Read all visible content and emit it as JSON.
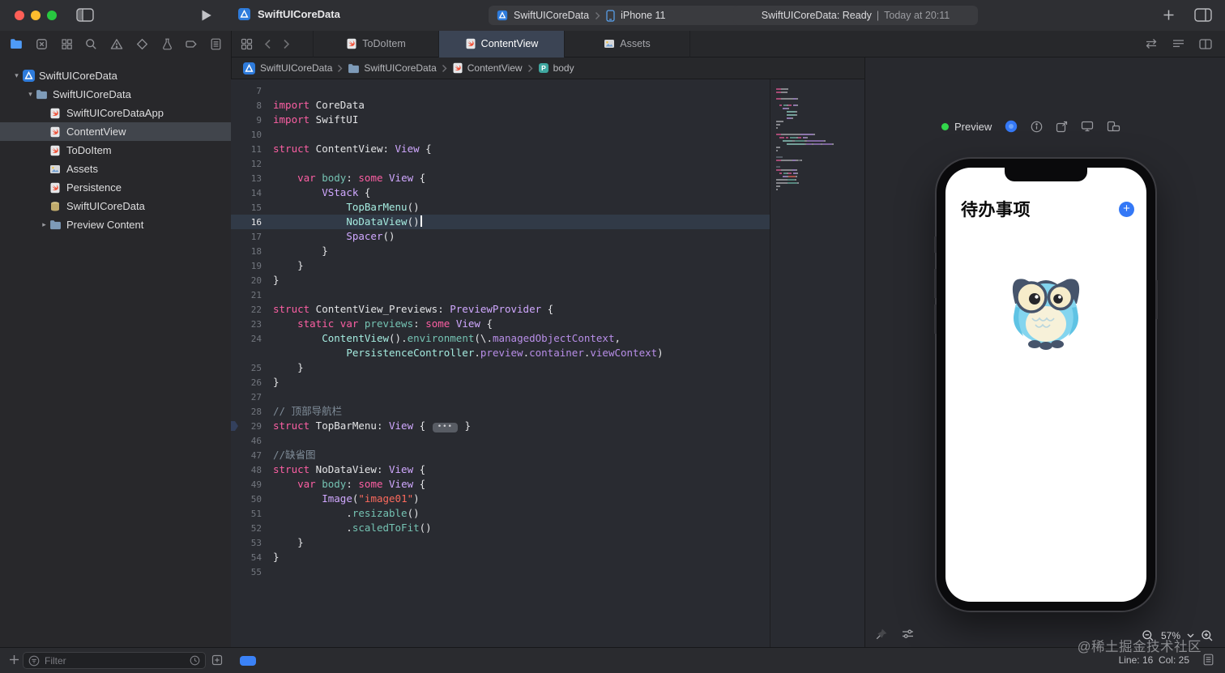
{
  "titlebar": {
    "title": "SwiftUICoreData",
    "scheme_app": "SwiftUICoreData",
    "scheme_device": "iPhone 11",
    "status_main": "SwiftUICoreData: Ready",
    "status_sep": "|",
    "status_time": "Today at 20:11"
  },
  "toolbar": {
    "tabs": [
      {
        "label": "ToDoItem",
        "icon": "swift",
        "active": false
      },
      {
        "label": "ContentView",
        "icon": "swift",
        "active": true
      },
      {
        "label": "Assets",
        "icon": "assets",
        "active": false
      }
    ]
  },
  "breadcrumb": {
    "items": [
      {
        "label": "SwiftUICoreData",
        "icon": "project"
      },
      {
        "label": "SwiftUICoreData",
        "icon": "folder"
      },
      {
        "label": "ContentView",
        "icon": "swift"
      },
      {
        "label": "body",
        "icon": "property"
      }
    ]
  },
  "sidebar": {
    "rows": [
      {
        "label": "SwiftUICoreData",
        "level": 0,
        "icon": "project",
        "disclosure": "open"
      },
      {
        "label": "SwiftUICoreData",
        "level": 1,
        "icon": "folder",
        "disclosure": "open"
      },
      {
        "label": "SwiftUICoreDataApp",
        "level": 2,
        "icon": "swift"
      },
      {
        "label": "ContentView",
        "level": 2,
        "icon": "swift",
        "selected": true
      },
      {
        "label": "ToDoItem",
        "level": 2,
        "icon": "swift"
      },
      {
        "label": "Assets",
        "level": 2,
        "icon": "assets"
      },
      {
        "label": "Persistence",
        "level": 2,
        "icon": "swift"
      },
      {
        "label": "SwiftUICoreData",
        "level": 2,
        "icon": "coredata"
      },
      {
        "label": "Preview Content",
        "level": 2,
        "icon": "folder",
        "disclosure": "closed"
      }
    ]
  },
  "editor": {
    "lines": [
      {
        "n": "7",
        "seg": []
      },
      {
        "n": "8",
        "seg": [
          [
            "k",
            "import"
          ],
          [
            "p",
            " CoreData"
          ]
        ]
      },
      {
        "n": "9",
        "seg": [
          [
            "k",
            "import"
          ],
          [
            "p",
            " SwiftUI"
          ]
        ]
      },
      {
        "n": "10",
        "seg": []
      },
      {
        "n": "11",
        "seg": [
          [
            "k",
            "struct"
          ],
          [
            "p",
            " ContentView: "
          ],
          [
            "t",
            "View"
          ],
          [
            "p",
            " {"
          ]
        ]
      },
      {
        "n": "12",
        "seg": []
      },
      {
        "n": "13",
        "seg": [
          [
            "p",
            "    "
          ],
          [
            "k",
            "var"
          ],
          [
            "p",
            " "
          ],
          [
            "f",
            "body"
          ],
          [
            "p",
            ": "
          ],
          [
            "k",
            "some"
          ],
          [
            "p",
            " "
          ],
          [
            "t",
            "View"
          ],
          [
            "p",
            " {"
          ]
        ]
      },
      {
        "n": "14",
        "seg": [
          [
            "p",
            "        "
          ],
          [
            "t",
            "VStack"
          ],
          [
            "p",
            " {"
          ]
        ]
      },
      {
        "n": "15",
        "seg": [
          [
            "p",
            "            "
          ],
          [
            "m",
            "TopBarMenu"
          ],
          [
            "p",
            "()"
          ]
        ]
      },
      {
        "n": "16",
        "seg": [
          [
            "p",
            "            "
          ],
          [
            "m",
            "NoDataView"
          ],
          [
            "p",
            "()"
          ]
        ],
        "hl": true,
        "cursor": true
      },
      {
        "n": "17",
        "seg": [
          [
            "p",
            "            "
          ],
          [
            "t",
            "Spacer"
          ],
          [
            "p",
            "()"
          ]
        ]
      },
      {
        "n": "18",
        "seg": [
          [
            "p",
            "        }"
          ]
        ]
      },
      {
        "n": "19",
        "seg": [
          [
            "p",
            "    }"
          ]
        ]
      },
      {
        "n": "20",
        "seg": [
          [
            "p",
            "}"
          ]
        ]
      },
      {
        "n": "21",
        "seg": []
      },
      {
        "n": "22",
        "seg": [
          [
            "k",
            "struct"
          ],
          [
            "p",
            " ContentView_Previews: "
          ],
          [
            "t",
            "PreviewProvider"
          ],
          [
            "p",
            " {"
          ]
        ]
      },
      {
        "n": "23",
        "seg": [
          [
            "p",
            "    "
          ],
          [
            "k",
            "static"
          ],
          [
            "p",
            " "
          ],
          [
            "k",
            "var"
          ],
          [
            "p",
            " "
          ],
          [
            "f",
            "previews"
          ],
          [
            "p",
            ": "
          ],
          [
            "k",
            "some"
          ],
          [
            "p",
            " "
          ],
          [
            "t",
            "View"
          ],
          [
            "p",
            " {"
          ]
        ]
      },
      {
        "n": "24",
        "seg": [
          [
            "p",
            "        "
          ],
          [
            "m",
            "ContentView"
          ],
          [
            "p",
            "()."
          ],
          [
            "f",
            "environment"
          ],
          [
            "p",
            "(\\."
          ],
          [
            "pu",
            "managedObjectContext"
          ],
          [
            "p",
            ","
          ]
        ]
      },
      {
        "n": "",
        "seg": [
          [
            "p",
            "            "
          ],
          [
            "m",
            "PersistenceController"
          ],
          [
            "p",
            "."
          ],
          [
            "pu",
            "preview"
          ],
          [
            "p",
            "."
          ],
          [
            "pu",
            "container"
          ],
          [
            "p",
            "."
          ],
          [
            "pu",
            "viewContext"
          ],
          [
            "p",
            ")"
          ]
        ]
      },
      {
        "n": "25",
        "seg": [
          [
            "p",
            "    }"
          ]
        ]
      },
      {
        "n": "26",
        "seg": [
          [
            "p",
            "}"
          ]
        ]
      },
      {
        "n": "27",
        "seg": []
      },
      {
        "n": "28",
        "seg": [
          [
            "c",
            "// 顶部导航栏"
          ]
        ]
      },
      {
        "n": "29",
        "seg": [
          [
            "k",
            "struct"
          ],
          [
            "p",
            " TopBarMenu: "
          ],
          [
            "t",
            "View"
          ],
          [
            "p",
            " { "
          ],
          [
            "fold",
            "•••"
          ],
          [
            "p",
            " }"
          ]
        ],
        "marker": true
      },
      {
        "n": "46",
        "seg": []
      },
      {
        "n": "47",
        "seg": [
          [
            "c",
            "//缺省图"
          ]
        ]
      },
      {
        "n": "48",
        "seg": [
          [
            "k",
            "struct"
          ],
          [
            "p",
            " NoDataView: "
          ],
          [
            "t",
            "View"
          ],
          [
            "p",
            " {"
          ]
        ]
      },
      {
        "n": "49",
        "seg": [
          [
            "p",
            "    "
          ],
          [
            "k",
            "var"
          ],
          [
            "p",
            " "
          ],
          [
            "f",
            "body"
          ],
          [
            "p",
            ": "
          ],
          [
            "k",
            "some"
          ],
          [
            "p",
            " "
          ],
          [
            "t",
            "View"
          ],
          [
            "p",
            " {"
          ]
        ]
      },
      {
        "n": "50",
        "seg": [
          [
            "p",
            "        "
          ],
          [
            "t",
            "Image"
          ],
          [
            "p",
            "("
          ],
          [
            "s",
            "\"image01\""
          ],
          [
            "p",
            ")"
          ]
        ]
      },
      {
        "n": "51",
        "seg": [
          [
            "p",
            "            ."
          ],
          [
            "f",
            "resizable"
          ],
          [
            "p",
            "()"
          ]
        ]
      },
      {
        "n": "52",
        "seg": [
          [
            "p",
            "            ."
          ],
          [
            "f",
            "scaledToFit"
          ],
          [
            "p",
            "()"
          ]
        ]
      },
      {
        "n": "53",
        "seg": [
          [
            "p",
            "    }"
          ]
        ]
      },
      {
        "n": "54",
        "seg": [
          [
            "p",
            "}"
          ]
        ]
      },
      {
        "n": "55",
        "seg": []
      }
    ]
  },
  "canvas": {
    "preview_label": "Preview",
    "zoom": "57%",
    "phone": {
      "nav_title": "待办事项",
      "add_label": "+"
    }
  },
  "statusbar": {
    "filter_placeholder": "Filter",
    "line_col": "Line: 16  Col: 25"
  },
  "watermark": "@稀土掘金技术社区",
  "colors": {
    "accent_blue": "#3478f6",
    "keyword_pink": "#fc5fa3",
    "type_lavender": "#d0a8ff",
    "project_type_mint": "#a5ece0",
    "string_salmon": "#fc6a5d",
    "comment_gray": "#7f8c98",
    "editor_bg": "#292b31",
    "selection_line": "#313a47"
  }
}
